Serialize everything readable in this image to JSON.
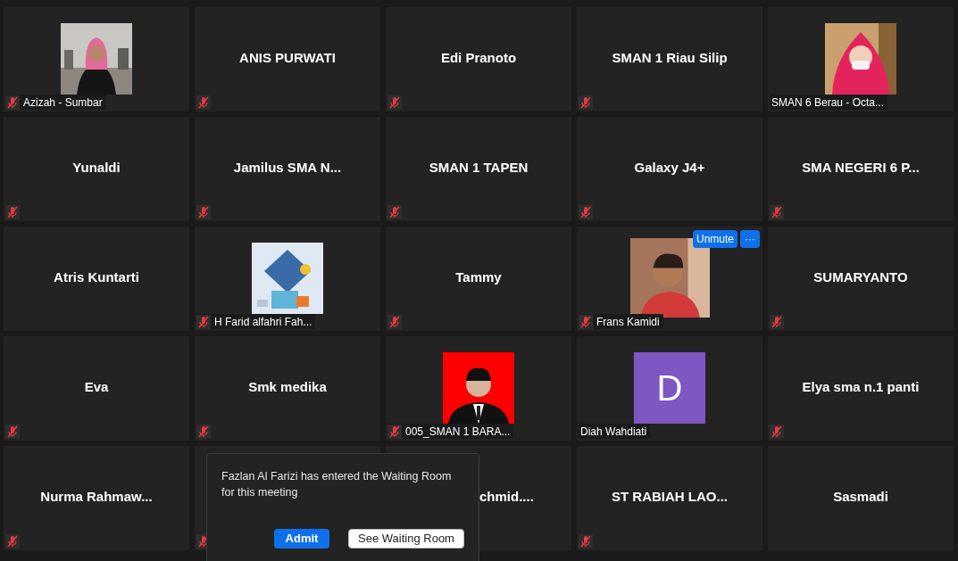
{
  "tiles": [
    {
      "kind": "picture",
      "name": "Azizah - Sumbar",
      "muted": true
    },
    {
      "kind": "name",
      "name": "ANIS PURWATI",
      "muted": true
    },
    {
      "kind": "name",
      "name": "Edi Pranoto",
      "muted": true
    },
    {
      "kind": "name",
      "name": "SMAN 1 Riau Silip",
      "muted": true
    },
    {
      "kind": "picture",
      "name": "SMAN 6 Berau - Octa...",
      "muted": false
    },
    {
      "kind": "name",
      "name": "Yunaldi",
      "muted": true
    },
    {
      "kind": "name",
      "name": "Jamilus SMA N...",
      "muted": true
    },
    {
      "kind": "name",
      "name": "SMAN 1 TAPEN",
      "muted": true
    },
    {
      "kind": "name",
      "name": "Galaxy J4+",
      "muted": true
    },
    {
      "kind": "name",
      "name": "SMA NEGERI 6 P...",
      "muted": true
    },
    {
      "kind": "name",
      "name": "Atris Kuntarti",
      "muted": false
    },
    {
      "kind": "picture",
      "name": "H Farid alfahri Fah...",
      "muted": true
    },
    {
      "kind": "name",
      "name": "Tammy",
      "muted": true
    },
    {
      "kind": "picture",
      "name": "Frans Kamidi",
      "muted": true,
      "hover_buttons": [
        "Unmute",
        "···"
      ]
    },
    {
      "kind": "name",
      "name": "SUMARYANTO",
      "muted": true
    },
    {
      "kind": "name",
      "name": "Eva",
      "muted": true
    },
    {
      "kind": "name",
      "name": "Smk medika",
      "muted": true
    },
    {
      "kind": "picture",
      "name": "005_SMAN 1 BARA...",
      "muted": true
    },
    {
      "kind": "avatar",
      "letter": "D",
      "name": "Diah Wahdiati",
      "muted": false
    },
    {
      "kind": "name",
      "name": "Elya sma n.1 panti",
      "muted": true
    },
    {
      "kind": "name",
      "name": "Nurma Rahmaw...",
      "muted": true
    },
    {
      "kind": "covered",
      "muted": true
    },
    {
      "kind": "covered",
      "name": "chmid...."
    },
    {
      "kind": "name",
      "name": "ST RABIAH LAO...",
      "muted": true
    },
    {
      "kind": "name",
      "name": "Sasmadi",
      "muted": false
    }
  ],
  "notification": {
    "message": "Fazlan Al Farizi has entered the Waiting Room for this meeting",
    "buttons": [
      {
        "label": "Admit",
        "primary": true
      },
      {
        "label": "See Waiting Room",
        "primary": false
      }
    ]
  }
}
